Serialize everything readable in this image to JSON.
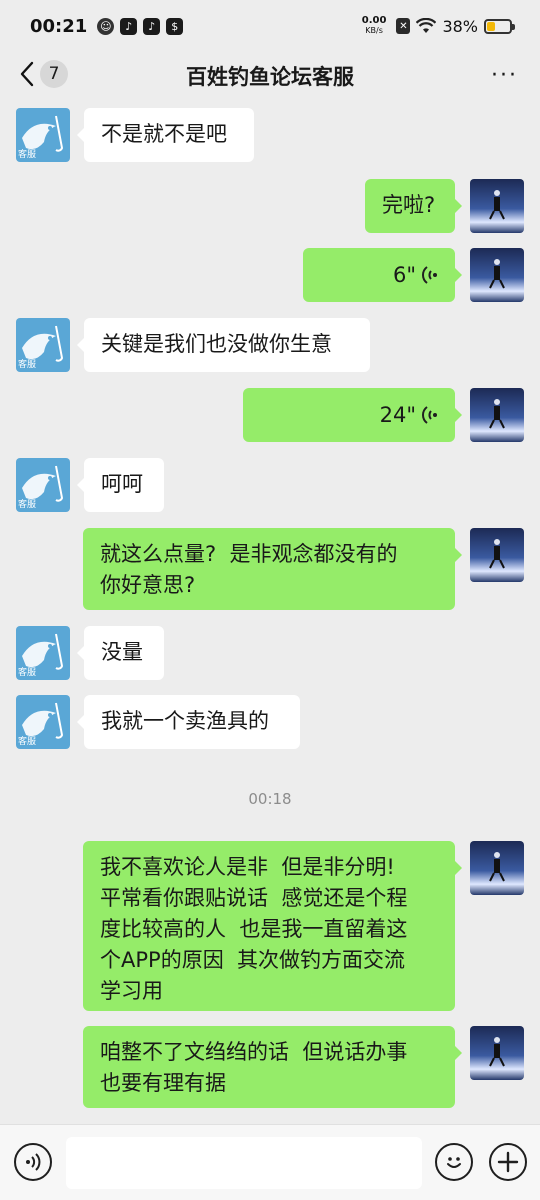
{
  "status": {
    "time": "00:21",
    "net_speed": "0.00",
    "net_unit": "KB/s",
    "battery_pct": "38%",
    "battery_level": 0.38
  },
  "nav": {
    "unread_count": "7",
    "title": "百姓钓鱼论坛客服",
    "more": "···"
  },
  "avatar_label": "客服",
  "messages": [
    {
      "side": "in",
      "text": "不是就不是吧"
    },
    {
      "side": "out",
      "text": "完啦?"
    },
    {
      "side": "out",
      "voice": true,
      "duration": "6\""
    },
    {
      "side": "in",
      "text": "关键是我们也没做你生意"
    },
    {
      "side": "out",
      "voice": true,
      "duration": "24\""
    },
    {
      "side": "in",
      "text": "呵呵"
    },
    {
      "side": "out",
      "text": "就这么点量?  是非观念都没有的\n你好意思?"
    },
    {
      "side": "in",
      "text": "没量"
    },
    {
      "side": "in",
      "text": "我就一个卖渔具的"
    },
    {
      "side": "time",
      "text": "00:18"
    },
    {
      "side": "out",
      "text": "我不喜欢论人是非  但是非分明!\n平常看你跟贴说话  感觉还是个程\n度比较高的人  也是我一直留着这\n个APP的原因  其次做钓方面交流\n学习用"
    },
    {
      "side": "out",
      "text": "咱整不了文绉绉的话  但说话办事\n也要有理有据"
    }
  ],
  "input": {
    "placeholder": ""
  }
}
